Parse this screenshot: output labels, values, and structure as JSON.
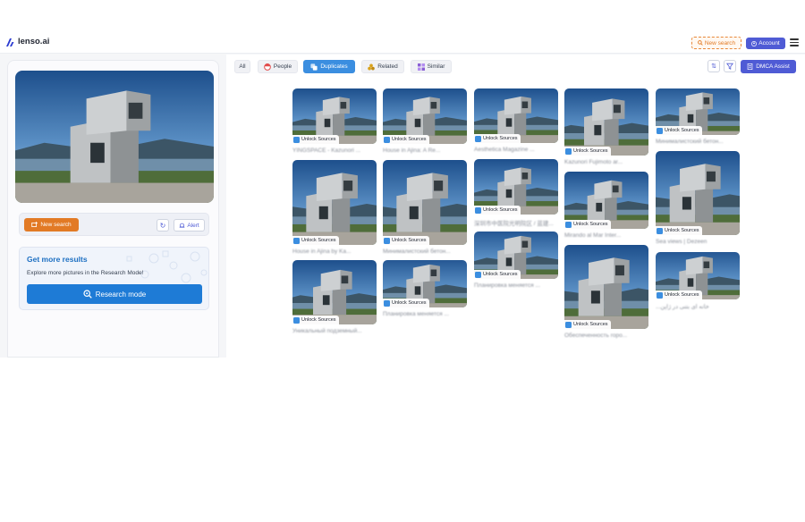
{
  "header": {
    "logo_text": "lenso.ai",
    "new_search_label": "New search",
    "account_label": "Account"
  },
  "query": {
    "new_search_label": "New search",
    "alert_label": "Alert"
  },
  "promo": {
    "title": "Get more results",
    "subtitle": "Explore more pictures in the Research Mode!",
    "button_label": "Research mode"
  },
  "filters": [
    {
      "label": "All",
      "active": false,
      "icon": ""
    },
    {
      "label": "People",
      "active": false,
      "icon": "face-icon"
    },
    {
      "label": "Duplicates",
      "active": true,
      "icon": "duplicates-icon"
    },
    {
      "label": "Related",
      "active": false,
      "icon": "related-icon"
    },
    {
      "label": "Similar",
      "active": false,
      "icon": "grid-icon"
    }
  ],
  "toolbar": {
    "dmca_label": "DMCA Assist"
  },
  "results": [
    {
      "unlock": "Unlock Sources",
      "caption": "YINGSPACE - Kazunori ..."
    },
    {
      "unlock": "Unlock Sources",
      "caption": "House in Ajina: A Re..."
    },
    {
      "unlock": "Unlock Sources",
      "caption": "Aesthetica Magazine ..."
    },
    {
      "unlock": "Unlock Sources",
      "caption": "Kazunori Fujimoto ar..."
    },
    {
      "unlock": "Unlock Sources",
      "caption": "Минималистский бетон..."
    },
    {
      "unlock": "Unlock Sources",
      "caption": "House in Ajina by Ka..."
    },
    {
      "unlock": "Unlock Sources",
      "caption": "Минималистский бетон..."
    },
    {
      "unlock": "Unlock Sources",
      "caption": "深圳市中医院光明院区 / 蓝建..."
    },
    {
      "unlock": "Unlock Sources",
      "caption": "Mirando al Mar Inter..."
    },
    {
      "unlock": "Unlock Sources",
      "caption": "Sea views | Dezeen"
    },
    {
      "unlock": "Unlock Sources",
      "caption": "Уникальный подземный..."
    },
    {
      "unlock": "Unlock Sources",
      "caption": "Планировка меняется ..."
    },
    {
      "unlock": "Unlock Sources",
      "caption": "Планировка меняется ..."
    },
    {
      "unlock": "Unlock Sources",
      "caption": "Обеспеченность горо..."
    },
    {
      "unlock": "Unlock Sources",
      "caption": "...خانه ای بتنی در ژاپن"
    }
  ],
  "colors": {
    "accent_orange": "#e27a25",
    "accent_indigo": "#4f5bd5",
    "accent_blue": "#1e7bd6",
    "active_chip": "#3b8ee0"
  }
}
